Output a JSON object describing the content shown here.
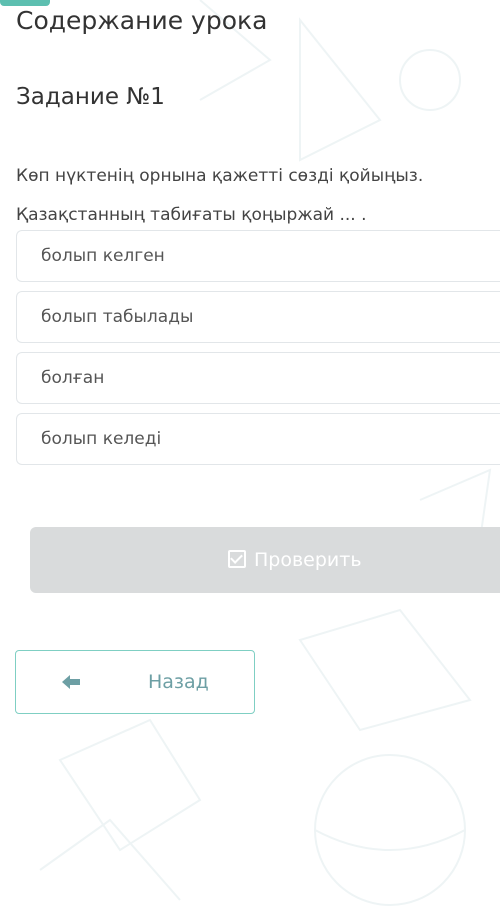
{
  "header": {
    "title": "Содержание урока"
  },
  "task": {
    "title": "Задание №1",
    "instruction": "Көп нүктенің орнына қажетті сөзді қойыңыз.",
    "sentence": "Қазақстанның табиғаты қоңыржай ... ."
  },
  "options": [
    {
      "label": "болып келген"
    },
    {
      "label": "болып табылады"
    },
    {
      "label": "болған"
    },
    {
      "label": "болып келеді"
    }
  ],
  "actions": {
    "check_label": "Проверить",
    "back_label": "Назад"
  },
  "colors": {
    "accent": "#5dbfb0",
    "check_button_bg": "#d9dbdc",
    "back_border": "#7fcfc3"
  },
  "icons": {
    "check": "checkbox-check-icon",
    "back": "arrow-left-icon"
  }
}
